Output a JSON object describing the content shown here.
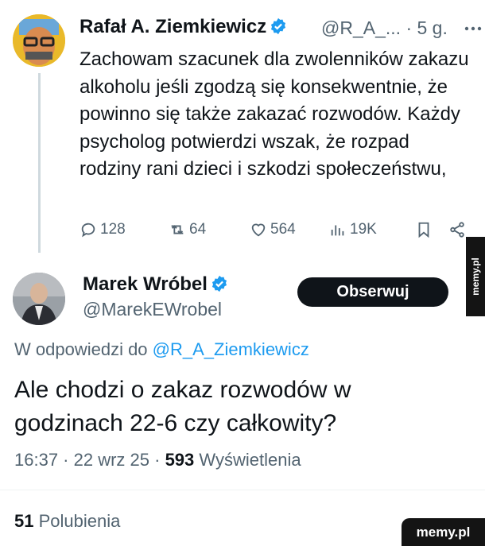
{
  "tweet": {
    "author_name": "Rafał A. Ziemkiewicz",
    "author_handle": "@R_A_...",
    "time": "· 5 g.",
    "text": "Zachowam szacunek dla zwolenników zakazu alkoholu jeśli zgodzą się konsekwentnie, że powinno się także zakazać rozwodów. Każdy psycholog potwierdzi wszak, że rozpad rodziny rani dzieci i szkodzi społeczeństwu,",
    "replies": "128",
    "retweets": "64",
    "likes": "564",
    "views": "19K"
  },
  "reply": {
    "author_name": "Marek Wróbel",
    "author_handle": "@MarekEWrobel",
    "follow_label": "Obserwuj",
    "reply_prefix": "W odpowiedzi do",
    "reply_mention": "@R_A_Ziemkiewicz",
    "text": "Ale chodzi o zakaz rozwodów w godzinach 22-6 czy całkowity?",
    "timestamp": "16:37 · 22 wrz 25 ·",
    "views_count": "593",
    "views_label": "Wyświetlenia",
    "likes_count": "51",
    "likes_label": "Polubienia"
  },
  "watermark": {
    "side": "memy.pl",
    "corner": "memy.pl"
  },
  "colors": {
    "accent": "#1d9bf0",
    "text": "#0f1419",
    "muted": "#536471",
    "button": "#0f1419"
  }
}
